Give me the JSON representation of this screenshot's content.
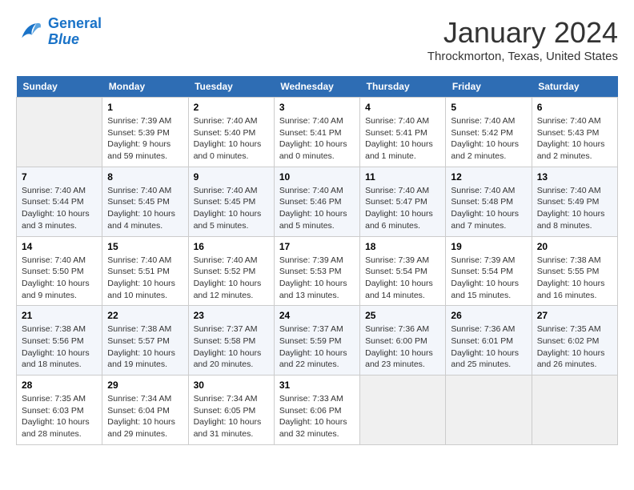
{
  "header": {
    "logo_line1": "General",
    "logo_line2": "Blue",
    "title": "January 2024",
    "subtitle": "Throckmorton, Texas, United States"
  },
  "days_of_week": [
    "Sunday",
    "Monday",
    "Tuesday",
    "Wednesday",
    "Thursday",
    "Friday",
    "Saturday"
  ],
  "weeks": [
    [
      {
        "day": "",
        "sunrise": "",
        "sunset": "",
        "daylight": ""
      },
      {
        "day": "1",
        "sunrise": "Sunrise: 7:39 AM",
        "sunset": "Sunset: 5:39 PM",
        "daylight": "Daylight: 9 hours and 59 minutes."
      },
      {
        "day": "2",
        "sunrise": "Sunrise: 7:40 AM",
        "sunset": "Sunset: 5:40 PM",
        "daylight": "Daylight: 10 hours and 0 minutes."
      },
      {
        "day": "3",
        "sunrise": "Sunrise: 7:40 AM",
        "sunset": "Sunset: 5:41 PM",
        "daylight": "Daylight: 10 hours and 0 minutes."
      },
      {
        "day": "4",
        "sunrise": "Sunrise: 7:40 AM",
        "sunset": "Sunset: 5:41 PM",
        "daylight": "Daylight: 10 hours and 1 minute."
      },
      {
        "day": "5",
        "sunrise": "Sunrise: 7:40 AM",
        "sunset": "Sunset: 5:42 PM",
        "daylight": "Daylight: 10 hours and 2 minutes."
      },
      {
        "day": "6",
        "sunrise": "Sunrise: 7:40 AM",
        "sunset": "Sunset: 5:43 PM",
        "daylight": "Daylight: 10 hours and 2 minutes."
      }
    ],
    [
      {
        "day": "7",
        "sunrise": "Sunrise: 7:40 AM",
        "sunset": "Sunset: 5:44 PM",
        "daylight": "Daylight: 10 hours and 3 minutes."
      },
      {
        "day": "8",
        "sunrise": "Sunrise: 7:40 AM",
        "sunset": "Sunset: 5:45 PM",
        "daylight": "Daylight: 10 hours and 4 minutes."
      },
      {
        "day": "9",
        "sunrise": "Sunrise: 7:40 AM",
        "sunset": "Sunset: 5:45 PM",
        "daylight": "Daylight: 10 hours and 5 minutes."
      },
      {
        "day": "10",
        "sunrise": "Sunrise: 7:40 AM",
        "sunset": "Sunset: 5:46 PM",
        "daylight": "Daylight: 10 hours and 5 minutes."
      },
      {
        "day": "11",
        "sunrise": "Sunrise: 7:40 AM",
        "sunset": "Sunset: 5:47 PM",
        "daylight": "Daylight: 10 hours and 6 minutes."
      },
      {
        "day": "12",
        "sunrise": "Sunrise: 7:40 AM",
        "sunset": "Sunset: 5:48 PM",
        "daylight": "Daylight: 10 hours and 7 minutes."
      },
      {
        "day": "13",
        "sunrise": "Sunrise: 7:40 AM",
        "sunset": "Sunset: 5:49 PM",
        "daylight": "Daylight: 10 hours and 8 minutes."
      }
    ],
    [
      {
        "day": "14",
        "sunrise": "Sunrise: 7:40 AM",
        "sunset": "Sunset: 5:50 PM",
        "daylight": "Daylight: 10 hours and 9 minutes."
      },
      {
        "day": "15",
        "sunrise": "Sunrise: 7:40 AM",
        "sunset": "Sunset: 5:51 PM",
        "daylight": "Daylight: 10 hours and 10 minutes."
      },
      {
        "day": "16",
        "sunrise": "Sunrise: 7:40 AM",
        "sunset": "Sunset: 5:52 PM",
        "daylight": "Daylight: 10 hours and 12 minutes."
      },
      {
        "day": "17",
        "sunrise": "Sunrise: 7:39 AM",
        "sunset": "Sunset: 5:53 PM",
        "daylight": "Daylight: 10 hours and 13 minutes."
      },
      {
        "day": "18",
        "sunrise": "Sunrise: 7:39 AM",
        "sunset": "Sunset: 5:54 PM",
        "daylight": "Daylight: 10 hours and 14 minutes."
      },
      {
        "day": "19",
        "sunrise": "Sunrise: 7:39 AM",
        "sunset": "Sunset: 5:54 PM",
        "daylight": "Daylight: 10 hours and 15 minutes."
      },
      {
        "day": "20",
        "sunrise": "Sunrise: 7:38 AM",
        "sunset": "Sunset: 5:55 PM",
        "daylight": "Daylight: 10 hours and 16 minutes."
      }
    ],
    [
      {
        "day": "21",
        "sunrise": "Sunrise: 7:38 AM",
        "sunset": "Sunset: 5:56 PM",
        "daylight": "Daylight: 10 hours and 18 minutes."
      },
      {
        "day": "22",
        "sunrise": "Sunrise: 7:38 AM",
        "sunset": "Sunset: 5:57 PM",
        "daylight": "Daylight: 10 hours and 19 minutes."
      },
      {
        "day": "23",
        "sunrise": "Sunrise: 7:37 AM",
        "sunset": "Sunset: 5:58 PM",
        "daylight": "Daylight: 10 hours and 20 minutes."
      },
      {
        "day": "24",
        "sunrise": "Sunrise: 7:37 AM",
        "sunset": "Sunset: 5:59 PM",
        "daylight": "Daylight: 10 hours and 22 minutes."
      },
      {
        "day": "25",
        "sunrise": "Sunrise: 7:36 AM",
        "sunset": "Sunset: 6:00 PM",
        "daylight": "Daylight: 10 hours and 23 minutes."
      },
      {
        "day": "26",
        "sunrise": "Sunrise: 7:36 AM",
        "sunset": "Sunset: 6:01 PM",
        "daylight": "Daylight: 10 hours and 25 minutes."
      },
      {
        "day": "27",
        "sunrise": "Sunrise: 7:35 AM",
        "sunset": "Sunset: 6:02 PM",
        "daylight": "Daylight: 10 hours and 26 minutes."
      }
    ],
    [
      {
        "day": "28",
        "sunrise": "Sunrise: 7:35 AM",
        "sunset": "Sunset: 6:03 PM",
        "daylight": "Daylight: 10 hours and 28 minutes."
      },
      {
        "day": "29",
        "sunrise": "Sunrise: 7:34 AM",
        "sunset": "Sunset: 6:04 PM",
        "daylight": "Daylight: 10 hours and 29 minutes."
      },
      {
        "day": "30",
        "sunrise": "Sunrise: 7:34 AM",
        "sunset": "Sunset: 6:05 PM",
        "daylight": "Daylight: 10 hours and 31 minutes."
      },
      {
        "day": "31",
        "sunrise": "Sunrise: 7:33 AM",
        "sunset": "Sunset: 6:06 PM",
        "daylight": "Daylight: 10 hours and 32 minutes."
      },
      {
        "day": "",
        "sunrise": "",
        "sunset": "",
        "daylight": ""
      },
      {
        "day": "",
        "sunrise": "",
        "sunset": "",
        "daylight": ""
      },
      {
        "day": "",
        "sunrise": "",
        "sunset": "",
        "daylight": ""
      }
    ]
  ]
}
